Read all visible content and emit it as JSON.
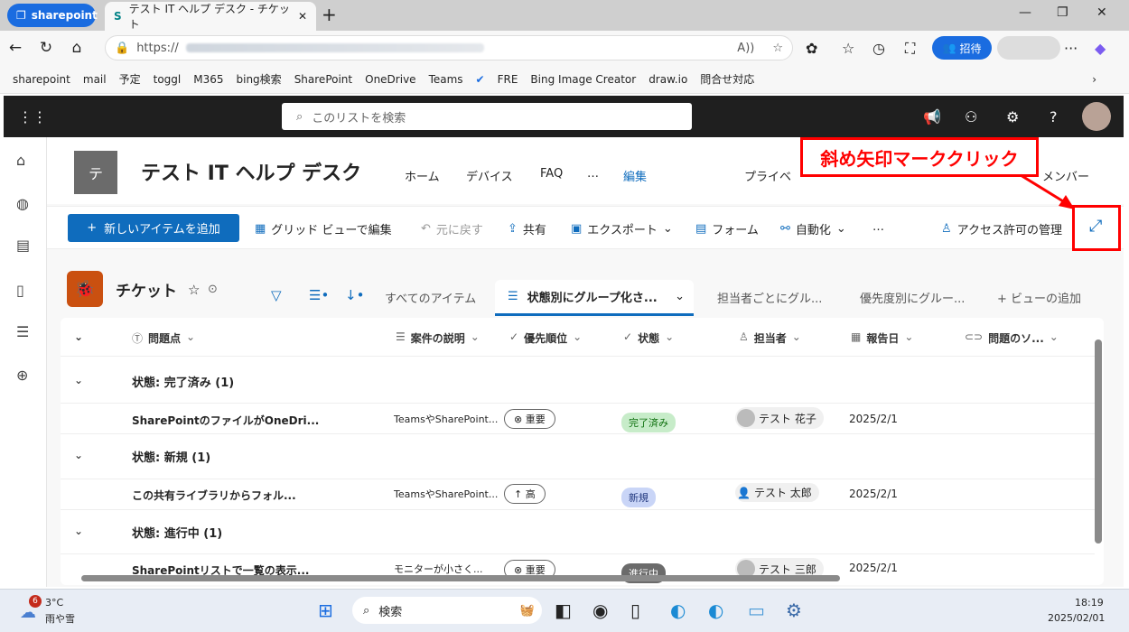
{
  "browser": {
    "profile": "sharepoint",
    "tab_title": "テスト IT ヘルプ デスク - チケット",
    "url_prefix": "https://",
    "invite_label": "招待",
    "bookmarks": [
      "sharepoint",
      "mail",
      "予定",
      "toggl",
      "M365",
      "bing検索",
      "SharePoint",
      "OneDrive",
      "Teams",
      "",
      "FRE",
      "Bing Image Creator",
      "draw.io",
      "問合せ対応"
    ]
  },
  "suite": {
    "search_placeholder": "このリストを検索"
  },
  "site": {
    "logo_letter": "テ",
    "name": "テスト IT ヘルプ デスク",
    "nav": [
      "ホーム",
      "デバイス",
      "FAQ",
      "…",
      "編集",
      "プライベ",
      "メンバー"
    ]
  },
  "commands": {
    "add": "新しいアイテムを追加",
    "grid": "グリッド ビューで編集",
    "undo": "元に戻す",
    "share": "共有",
    "export": "エクスポート",
    "form": "フォーム",
    "automate": "自動化",
    "more": "…",
    "access": "アクセス許可の管理"
  },
  "list": {
    "name": "チケット",
    "views": [
      "すべてのアイテム",
      "状態別にグループ化さ...",
      "担当者ごとにグル...",
      "優先度別にグルー...",
      "ビューの追加"
    ]
  },
  "columns": [
    "問題点",
    "案件の説明",
    "優先順位",
    "状態",
    "担当者",
    "報告日",
    "問題のソ..."
  ],
  "groups": [
    {
      "label": "状態: 完了済み (1)",
      "row": {
        "title": "SharePointのファイルがOneDri...",
        "desc": "TeamsやSharePoint...",
        "priority": "重要",
        "status": "完了済み",
        "assignee": "テスト 花子",
        "date": "2025/2/1"
      }
    },
    {
      "label": "状態: 新規 (1)",
      "row": {
        "title": "この共有ライブラリからフォル...",
        "desc": "TeamsやSharePoint...",
        "priority": "高",
        "status": "新規",
        "assignee": "テスト 太郎",
        "date": "2025/2/1"
      }
    },
    {
      "label": "状態: 進行中 (1)",
      "row": {
        "title": "SharePointリストで一覧の表示...",
        "desc": "モニターが小さく...",
        "priority": "重要",
        "status": "進行中",
        "assignee": "テスト 三郎",
        "date": "2025/2/1"
      }
    }
  ],
  "status_colors": {
    "完了済み": "#c7ecc9",
    "新規": "#c9d5f7",
    "進行中": "#6b6b6b"
  },
  "annotation": "斜め矢印マーククリック",
  "taskbar": {
    "weather_badge": "6",
    "temp": "3°C",
    "weather": "雨や雪",
    "search": "検索",
    "time": "18:19",
    "date": "2025/02/01"
  }
}
